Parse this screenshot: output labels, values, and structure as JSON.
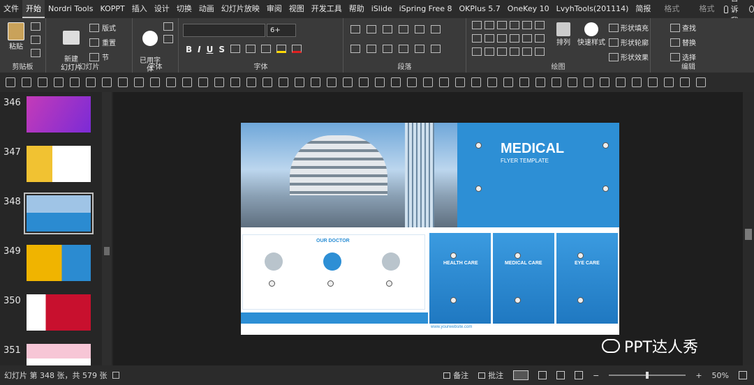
{
  "tabs": [
    "文件",
    "开始",
    "Nordri Tools",
    "KOPPT",
    "插入",
    "设计",
    "切换",
    "动画",
    "幻灯片放映",
    "审阅",
    "视图",
    "开发工具",
    "帮助",
    "iSlide",
    "iSpring Free 8",
    "OKPlus 5.7",
    "OneKey 10",
    "LvyhTools(201114)",
    "简报"
  ],
  "context_tabs": [
    "格式",
    "格式"
  ],
  "tell_me": "告诉我",
  "share": "共享",
  "ribbon": {
    "clipboard": {
      "label": "剪贴板",
      "paste": "粘贴"
    },
    "slides": {
      "label": "幻灯片",
      "new_slide": "新建\n幻灯片",
      "layout": "版式",
      "reset": "重置",
      "section": "节"
    },
    "font_style": {
      "label": "字体",
      "button": "已用字\n体"
    },
    "font": {
      "label": "字体",
      "size": "6+"
    },
    "paragraph": {
      "label": "段落"
    },
    "drawing": {
      "label": "绘图",
      "arrange": "排列",
      "quick_style": "快速样式",
      "fill": "形状填充",
      "outline": "形状轮廓",
      "effect": "形状效果"
    },
    "editing": {
      "label": "编辑",
      "find": "查找",
      "replace": "替换",
      "select": "选择"
    }
  },
  "thumbnails": [
    {
      "num": "346",
      "color": "#c43bb8"
    },
    {
      "num": "347",
      "color": "#f1c232"
    },
    {
      "num": "348",
      "color": "#2b8bd1"
    },
    {
      "num": "349",
      "color": "#f0b400"
    },
    {
      "num": "350",
      "color": "#c8102e"
    },
    {
      "num": "351",
      "color": "#f7c6d6"
    }
  ],
  "slide": {
    "title": "MEDICAL",
    "subtitle": "FLYER TEMPLATE",
    "doctor_header": "OUR DOCTOR",
    "services": [
      "HEALTH CARE",
      "MEDICAL CARE",
      "EYE CARE"
    ],
    "footer_url": "www.yourwebsite.com"
  },
  "status": {
    "slide_info": "幻灯片 第 348 张，共 579 张",
    "notes": "备注",
    "comments": "批注",
    "zoom": "50%",
    "zoom_fraction": 0.5
  },
  "watermark": "PPT达人秀"
}
